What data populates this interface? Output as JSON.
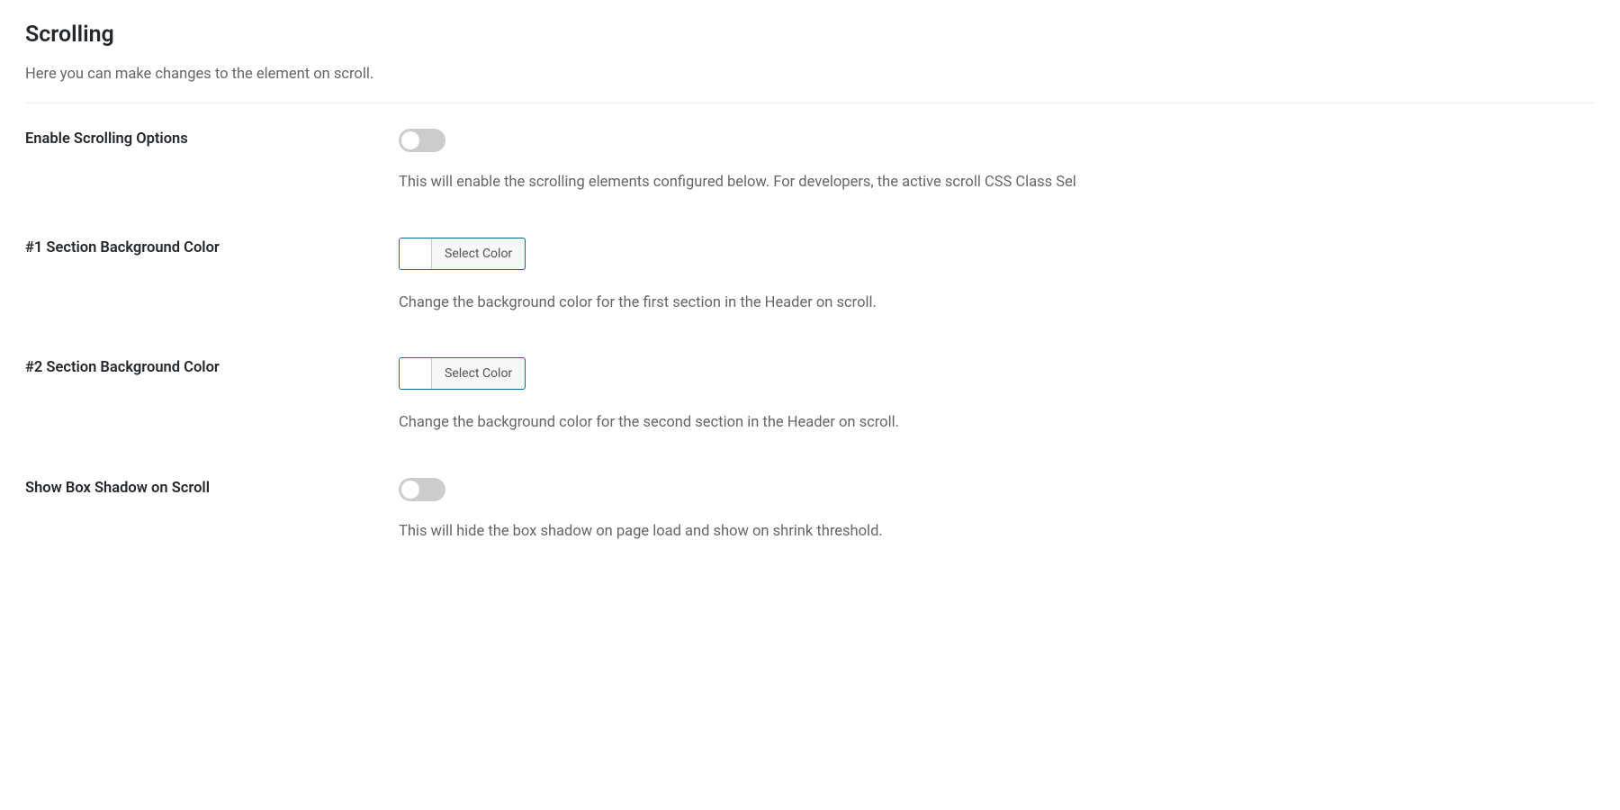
{
  "section": {
    "title": "Scrolling",
    "description": "Here you can make changes to the element on scroll."
  },
  "fields": {
    "enable_scrolling": {
      "label": "Enable Scrolling Options",
      "help": "This will enable the scrolling elements configured below. For developers, the active scroll CSS Class Sel",
      "value": false
    },
    "section1_bg": {
      "label": "#1 Section Background Color",
      "button_text": "Select Color",
      "help": "Change the background color for the first section in the Header on scroll."
    },
    "section2_bg": {
      "label": "#2 Section Background Color",
      "button_text": "Select Color",
      "help": "Change the background color for the second section in the Header on scroll."
    },
    "box_shadow": {
      "label": "Show Box Shadow on Scroll",
      "help": "This will hide the box shadow on page load and show on shrink threshold.",
      "value": false
    }
  }
}
